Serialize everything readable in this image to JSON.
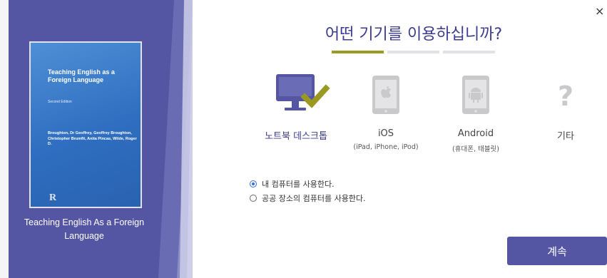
{
  "dialog": {
    "title": "어떤 기기를 이용하십니까?",
    "close_icon": "×",
    "progress": {
      "total_steps": 3,
      "current_step": 1
    },
    "colors": {
      "accent": "#5456a4",
      "progress_active": "#9a9a22",
      "check": "#9a9a22",
      "title": "#3b3b8f"
    }
  },
  "book": {
    "cover_title": "Teaching English as a Foreign Language",
    "cover_edition": "Second Edition",
    "cover_authors": "Broughton, Dr Geoffrey, Geoffrey Broughton, Christopher Brumfit, Anita Pincas, Wilde, Roger D.",
    "cover_logo": "R",
    "caption": "Teaching English As a Foreign Language"
  },
  "devices": [
    {
      "label": "노트북 데스크톱",
      "sub": "",
      "icon": "desktop-check-icon",
      "selected": true
    },
    {
      "label": "iOS",
      "sub": "(iPad, iPhone, iPod)",
      "icon": "apple-tablet-icon",
      "selected": false
    },
    {
      "label": "Android",
      "sub": "(휴대폰, 태블릿)",
      "icon": "android-tablet-icon",
      "selected": false
    },
    {
      "label": "기타",
      "sub": "",
      "icon": "question-icon",
      "selected": false
    }
  ],
  "radios": [
    {
      "label": "내 컴퓨터를 사용한다.",
      "checked": true
    },
    {
      "label": "공공 장소의 컴퓨터를 사용한다.",
      "checked": false
    }
  ],
  "continue_label": "계속"
}
